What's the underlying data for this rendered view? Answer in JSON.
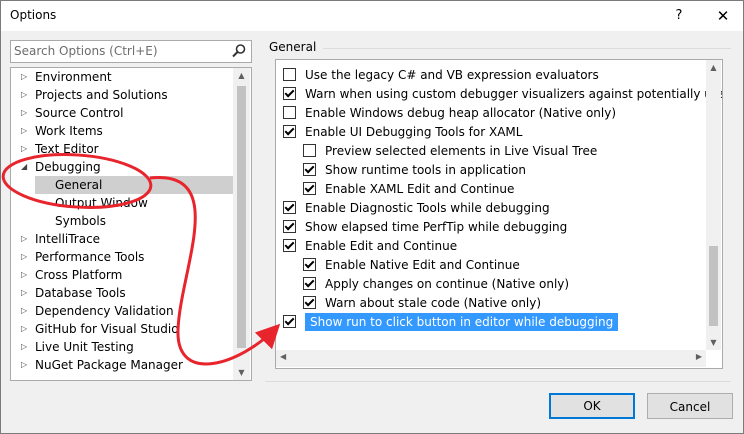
{
  "window": {
    "title": "Options",
    "help_label": "?",
    "close_label": "✕"
  },
  "search": {
    "placeholder": "Search Options (Ctrl+E)"
  },
  "tree": {
    "items": [
      {
        "label": "Environment",
        "expanded": false
      },
      {
        "label": "Projects and Solutions",
        "expanded": false
      },
      {
        "label": "Source Control",
        "expanded": false
      },
      {
        "label": "Work Items",
        "expanded": false
      },
      {
        "label": "Text Editor",
        "expanded": false
      },
      {
        "label": "Debugging",
        "expanded": true
      },
      {
        "label": "General",
        "selected": true
      },
      {
        "label": "Output Window"
      },
      {
        "label": "Symbols"
      },
      {
        "label": "IntelliTrace",
        "expanded": false
      },
      {
        "label": "Performance Tools",
        "expanded": false
      },
      {
        "label": "Cross Platform",
        "expanded": false
      },
      {
        "label": "Database Tools",
        "expanded": false
      },
      {
        "label": "Dependency Validation",
        "expanded": false
      },
      {
        "label": "GitHub for Visual Studio",
        "expanded": false
      },
      {
        "label": "Live Unit Testing",
        "expanded": false
      },
      {
        "label": "NuGet Package Manager",
        "expanded": false
      }
    ]
  },
  "main": {
    "group_title": "General",
    "options": [
      {
        "label": "Use the legacy C# and VB expression evaluators",
        "checked": false
      },
      {
        "label": "Warn when using custom debugger visualizers against potentially unsafe pro",
        "checked": true
      },
      {
        "label": "Enable Windows debug heap allocator (Native only)",
        "checked": false
      },
      {
        "label": "Enable UI Debugging Tools for XAML",
        "checked": true
      },
      {
        "label": "Preview selected elements in Live Visual Tree",
        "checked": false
      },
      {
        "label": "Show runtime tools in application",
        "checked": true
      },
      {
        "label": "Enable XAML Edit and Continue",
        "checked": true
      },
      {
        "label": "Enable Diagnostic Tools while debugging",
        "checked": true
      },
      {
        "label": "Show elapsed time PerfTip while debugging",
        "checked": true
      },
      {
        "label": "Enable Edit and Continue",
        "checked": true
      },
      {
        "label": "Enable Native Edit and Continue",
        "checked": true
      },
      {
        "label": "Apply changes on continue (Native only)",
        "checked": true
      },
      {
        "label": "Warn about stale code (Native only)",
        "checked": true
      },
      {
        "label": "Show run to click button in editor while debugging",
        "checked": true,
        "selected": true
      }
    ]
  },
  "buttons": {
    "ok": "OK",
    "cancel": "Cancel"
  },
  "colors": {
    "selection": "#3399ff",
    "tree_selection": "#cfcfcf",
    "annotation": "#e8242c",
    "primary_border": "#0078d7"
  }
}
